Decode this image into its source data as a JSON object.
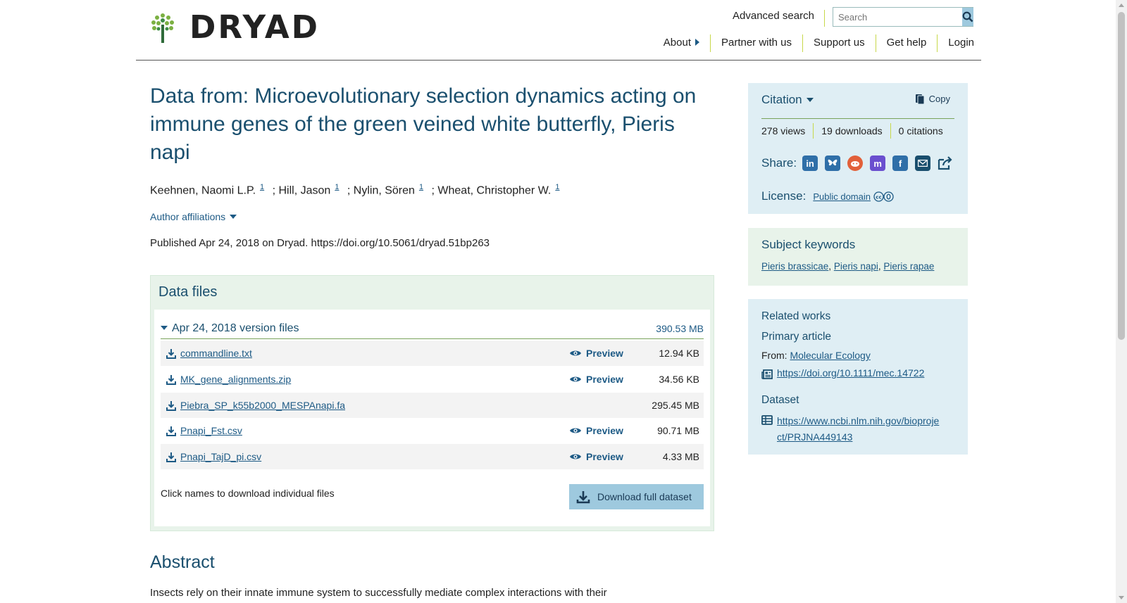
{
  "header": {
    "logo_text": "DRYAD",
    "advanced_search": "Advanced search",
    "search_placeholder": "Search",
    "nav": [
      "About",
      "Partner with us",
      "Support us",
      "Get help",
      "Login"
    ]
  },
  "dataset": {
    "title": "Data from: Microevolutionary selection dynamics acting on immune genes of the green veined white butterfly, Pieris napi",
    "authors": [
      {
        "name": "Keehnen, Naomi L.P.",
        "aff": "1"
      },
      {
        "name": "; Hill, Jason",
        "aff": "1"
      },
      {
        "name": "; Nylin, Sören",
        "aff": "1"
      },
      {
        "name": "; Wheat, Christopher W.",
        "aff": "1"
      }
    ],
    "author_affiliations": "Author affiliations",
    "published": "Published Apr 24, 2018 on Dryad. https://doi.org/10.5061/dryad.51bp263"
  },
  "files": {
    "heading": "Data files",
    "version_label": "Apr 24, 2018 version files",
    "version_size": "390.53 MB",
    "preview_label": "Preview",
    "list": [
      {
        "name": "commandline.txt",
        "size": "12.94 KB",
        "preview": true
      },
      {
        "name": "MK_gene_alignments.zip",
        "size": "34.56 KB",
        "preview": true
      },
      {
        "name": "Piebra_SP_k55b2000_MESPAnapi.fa",
        "size": "295.45 MB",
        "preview": false
      },
      {
        "name": "Pnapi_Fst.csv",
        "size": "90.71 MB",
        "preview": true
      },
      {
        "name": "Pnapi_TajD_pi.csv",
        "size": "4.33 MB",
        "preview": true
      }
    ],
    "note": "Click names to download individual files",
    "download_full": "Download full dataset"
  },
  "abstract": {
    "heading": "Abstract",
    "text": "Insects rely on their innate immune system to successfully mediate complex interactions with their"
  },
  "citation": {
    "heading": "Citation",
    "copy": "Copy",
    "views": "278 views",
    "downloads": "19 downloads",
    "citations": "0 citations",
    "share_label": "Share:",
    "share_icons": [
      "linkedin-icon",
      "bluesky-icon",
      "reddit-icon",
      "mastodon-icon",
      "facebook-icon",
      "email-icon",
      "share-icon"
    ],
    "license_label": "License:",
    "license_value": "Public domain"
  },
  "keywords": {
    "heading": "Subject keywords",
    "items": [
      "Pieris brassicae",
      "Pieris napi",
      "Pieris rapae"
    ]
  },
  "related": {
    "heading": "Related works",
    "primary_heading": "Primary article",
    "from_label": "From:",
    "journal": "Molecular Ecology",
    "article_doi": "https://doi.org/10.1111/mec.14722",
    "dataset_heading": "Dataset",
    "dataset_link_line1": "https://www.ncbi.nlm.nih.gov/bioproje",
    "dataset_link_line2": "ct/PRJNA449143"
  },
  "colors": {
    "brand_blue": "#1a4f6e",
    "link": "#1d5a85",
    "accent_green": "#79a35a",
    "button_blue": "#9ec9de"
  }
}
